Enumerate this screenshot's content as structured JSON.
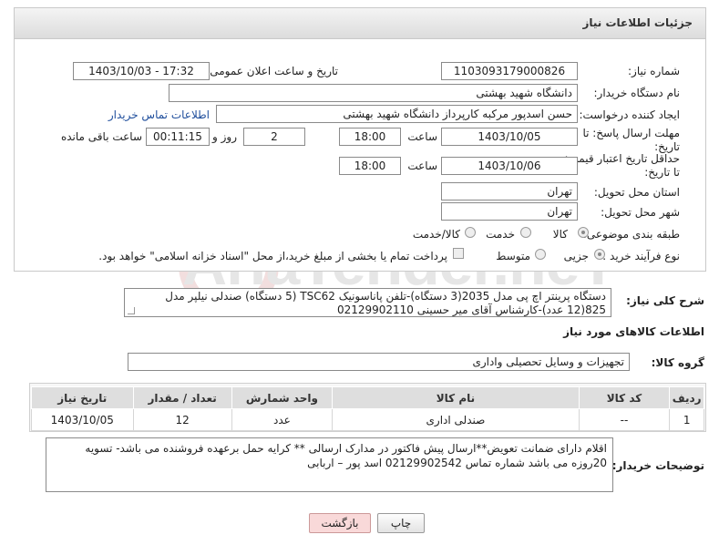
{
  "header": {
    "title": "جزئیات اطلاعات نیاز"
  },
  "form": {
    "need_number": {
      "label": "شماره نیاز:",
      "value": "1103093179000826"
    },
    "announce_datetime": {
      "label": "تاریخ و ساعت اعلان عمومی:",
      "value": "1403/10/03 - 17:32"
    },
    "buyer_org": {
      "label": "نام دستگاه خریدار:",
      "value": "دانشگاه شهید بهشتی"
    },
    "requester": {
      "label": "ایجاد کننده درخواست:",
      "value": "حسن اسدپور مرکبه کارپرداز دانشگاه شهید بهشتی",
      "contact_link": "اطلاعات تماس خریدار"
    },
    "reply_deadline": {
      "label": "مهلت ارسال پاسخ: تا تاریخ:",
      "date": "1403/10/05",
      "time_label": "ساعت",
      "time": "18:00",
      "days": "2",
      "days_label": "روز و",
      "remaining": "00:11:15",
      "remaining_label": "ساعت باقی مانده"
    },
    "price_validity": {
      "label": "حداقل تاریخ اعتبار قیمت: تا تاریخ:",
      "date": "1403/10/06",
      "time_label": "ساعت",
      "time": "18:00"
    },
    "province": {
      "label": "استان محل تحویل:",
      "value": "تهران"
    },
    "city": {
      "label": "شهر محل تحویل:",
      "value": "تهران"
    },
    "category": {
      "label": "طبقه بندی موضوعی:",
      "options": [
        "کالا",
        "خدمت",
        "کالا/خدمت"
      ],
      "selected": "کالا"
    },
    "purchase_type": {
      "label": "نوع فرآیند خرید :",
      "options": [
        "جزیی",
        "متوسط"
      ],
      "selected": "جزیی",
      "treasury_note": "پرداخت تمام یا بخشی از مبلغ خرید،از محل \"اسناد خزانه اسلامی\" خواهد بود."
    }
  },
  "description": {
    "label": "شرح کلی نیاز:",
    "text": "دستگاه پرینتر اچ پی مدل 2035(3 دستگاه)-تلفن پاناسونیک TSC62 (5 دستگاه) صندلی نیلپر مدل 825(12 عدد)-کارشناس آقای میر حسینی 02129902110"
  },
  "goods_info": {
    "heading": "اطلاعات کالاهای مورد نیاز",
    "group_label": "گروه کالا:",
    "group_value": "تجهیزات و وسایل تحصیلی واداری"
  },
  "items_table": {
    "headers": [
      "ردیف",
      "کد کالا",
      "نام کالا",
      "واحد شمارش",
      "تعداد / مقدار",
      "تاریخ نیاز"
    ],
    "rows": [
      [
        "1",
        "--",
        "صندلی اداری",
        "عدد",
        "12",
        "1403/10/05"
      ]
    ]
  },
  "buyer_notes": {
    "label": "توضیحات خریدار:",
    "text": "اقلام دارای ضمانت تعویض**ارسال پیش فاکتور در مدارک ارسالی ** کرایه حمل برعهده فروشنده می باشد- تسویه 20روزه می باشد شماره تماس 02129902542 اسد پور – اربابی"
  },
  "buttons": {
    "print": "چاپ",
    "back": "بازگشت"
  },
  "watermark": "AriaTender.neT",
  "colors": {
    "header_bg": "#dcdcdc",
    "link": "#1f4e9c",
    "back_button": "#f9d9d9"
  }
}
